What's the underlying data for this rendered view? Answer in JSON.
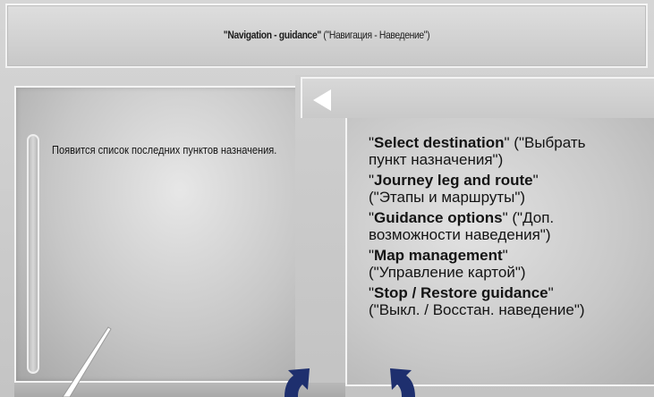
{
  "title": {
    "bold": "\"Navigation - guidance\"",
    "rest": " (\"Навигация - Наведение\")"
  },
  "left_panel": {
    "text": "Появится список последних пунктов назначения."
  },
  "menu": {
    "items": [
      {
        "en": "Select destination",
        "ru1": "\" (\"Выбрать",
        "ru2": "пункт назначения\")"
      },
      {
        "en": "Journey leg and route",
        "ru1": "\"",
        "ru2": "(\"Этапы и маршруты\")"
      },
      {
        "en": "Guidance options",
        "ru1": "\" (\"Доп.",
        "ru2": "возможности наведения\")"
      },
      {
        "en": "Map management",
        "ru1": "\"",
        "ru2": "(\"Управление картой\")"
      },
      {
        "en": "Stop / Restore guidance",
        "ru1": "\"",
        "ru2": "(\"Выкл. / Восстан. наведение\")"
      }
    ]
  },
  "icons": {
    "back": "triangle-left-icon",
    "scroll": "scrollbar-track",
    "callout_arrows": "navy-curved-arrow-icon"
  },
  "colors": {
    "arrow": "#1e2f6e",
    "panel_border": "#f4f4f4",
    "text": "#141414"
  }
}
